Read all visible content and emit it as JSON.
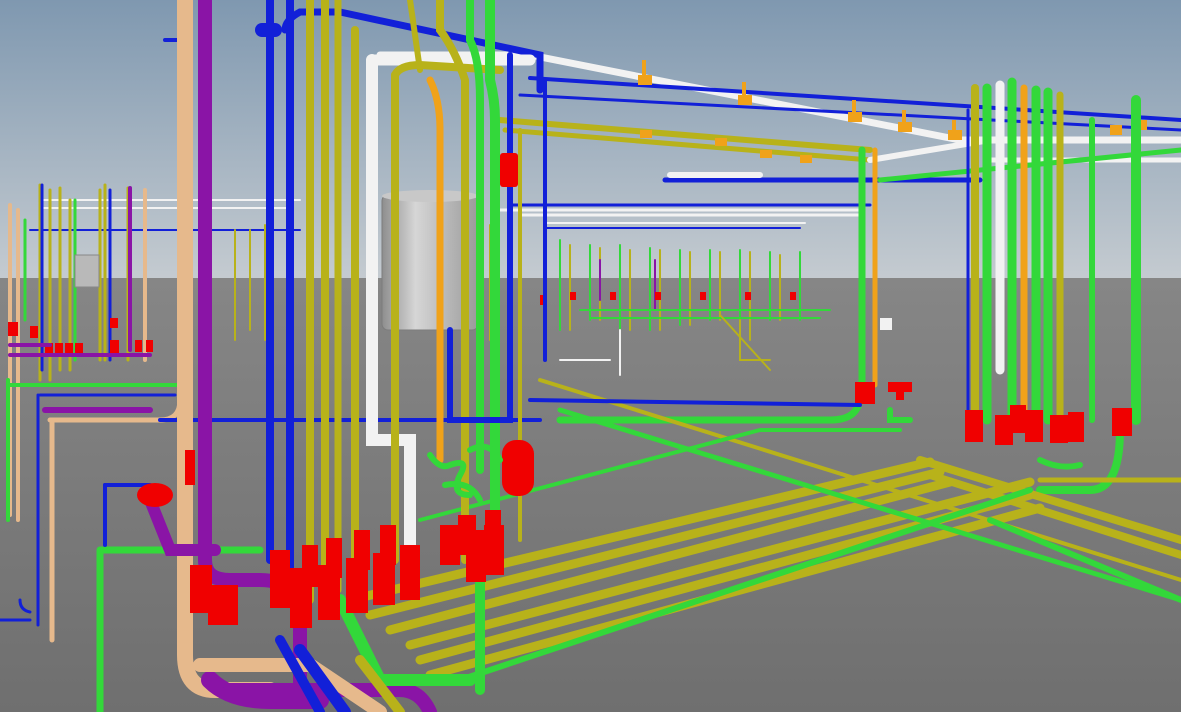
{
  "viewport": {
    "sky_top": "#7f98b0",
    "sky_bottom": "#c6ccd1",
    "floor_near": "#6f6f6f",
    "floor_far": "#868686"
  },
  "colors": {
    "blue": "#1220d8",
    "green": "#33d83a",
    "yellow": "#b8b21a",
    "orange": "#f0a21a",
    "white": "#f2f2f2",
    "purple": "#8a14a6",
    "tan": "#e6b98c",
    "red": "#f00000",
    "tank": "#b9b9b9"
  }
}
